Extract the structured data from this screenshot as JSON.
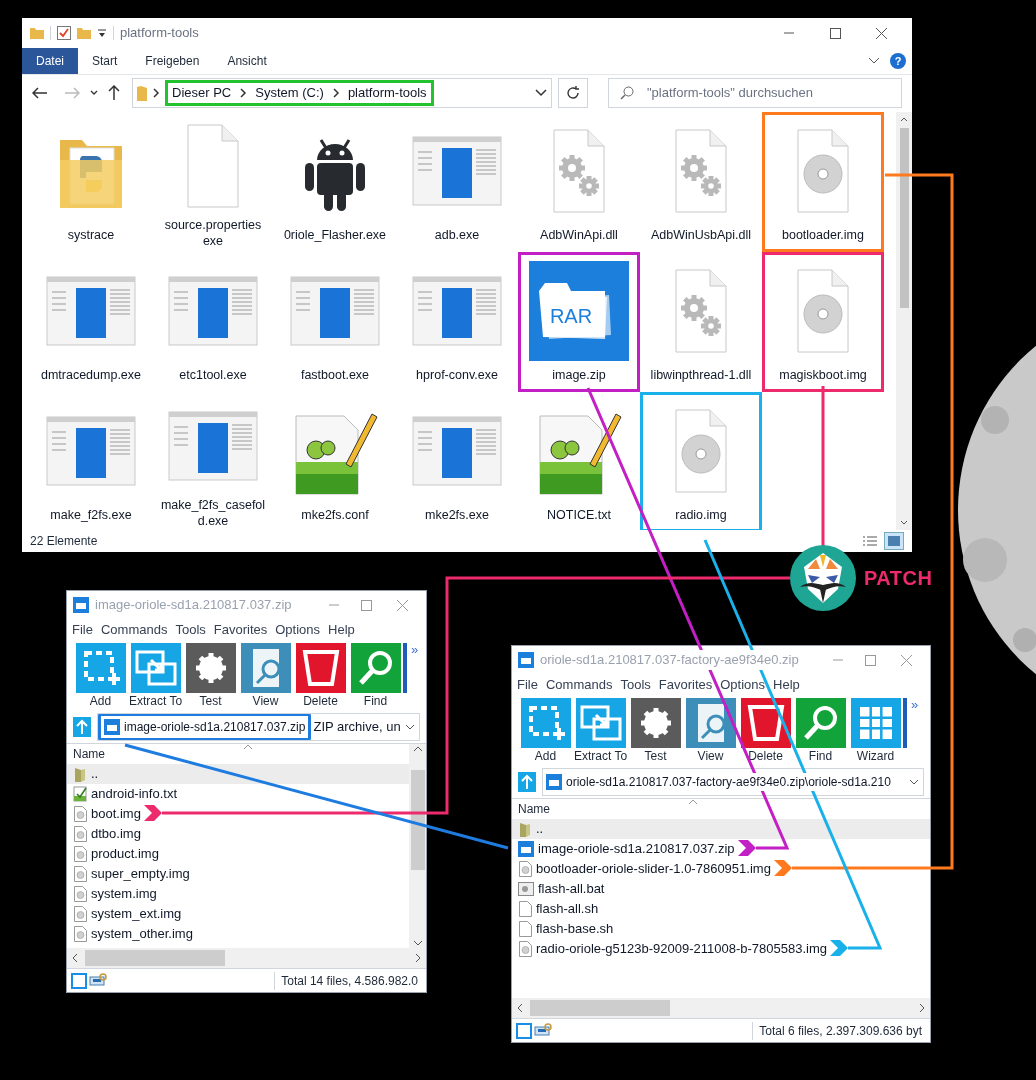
{
  "explorer": {
    "title": "platform-tools",
    "tabs": [
      {
        "label": "Datei",
        "selected": true
      },
      {
        "label": "Start",
        "selected": false
      },
      {
        "label": "Freigeben",
        "selected": false
      },
      {
        "label": "Ansicht",
        "selected": false
      }
    ],
    "help_label": "?",
    "address": {
      "crumbs": [
        "Dieser PC",
        "System (C:)",
        "platform-tools"
      ],
      "color": "#22c32e"
    },
    "search": {
      "placeholder": "\"platform-tools\" durchsuchen"
    },
    "files": [
      {
        "name": "systrace",
        "kind": "folder"
      },
      {
        "name": "source.properties exe",
        "kind": "blank"
      },
      {
        "name": "0riole_Flasher.exe",
        "kind": "android"
      },
      {
        "name": "adb.exe",
        "kind": "app"
      },
      {
        "name": "AdbWinApi.dll",
        "kind": "dll"
      },
      {
        "name": "AdbWinUsbApi.dll",
        "kind": "dll"
      },
      {
        "name": "bootloader.img",
        "kind": "disc",
        "color": "#ff7a1f"
      },
      {
        "name": "dmtracedump.exe",
        "kind": "app"
      },
      {
        "name": "etc1tool.exe",
        "kind": "app"
      },
      {
        "name": "fastboot.exe",
        "kind": "app"
      },
      {
        "name": "hprof-conv.exe",
        "kind": "app"
      },
      {
        "name": "image.zip",
        "kind": "rar",
        "badge": "RAR",
        "color": "#c21fc4"
      },
      {
        "name": "libwinpthread-1.dll",
        "kind": "dll"
      },
      {
        "name": "magiskboot.img",
        "kind": "disc",
        "color": "#ec2a6c"
      },
      {
        "name": "make_f2fs.exe",
        "kind": "app"
      },
      {
        "name": "make_f2fs_casefold.exe",
        "kind": "app"
      },
      {
        "name": "mke2fs.conf",
        "kind": "notepad"
      },
      {
        "name": "mke2fs.exe",
        "kind": "app"
      },
      {
        "name": "NOTICE.txt",
        "kind": "notepad"
      },
      {
        "name": "radio.img",
        "kind": "disc",
        "color": "#1ab0ea"
      }
    ],
    "status": "22 Elemente"
  },
  "archives": [
    {
      "title": "image-oriole-sd1a.210817.037.zip",
      "menu": [
        "File",
        "Commands",
        "Tools",
        "Favorites",
        "Options",
        "Help"
      ],
      "tools": [
        {
          "label": "Add",
          "kind": "add",
          "color": "#16a6e6"
        },
        {
          "label": "Extract To",
          "kind": "extract",
          "color": "#16a6e6"
        },
        {
          "label": "Test",
          "kind": "test",
          "color": "#5b5b5b"
        },
        {
          "label": "View",
          "kind": "view",
          "color": "#3d8fba"
        },
        {
          "label": "Delete",
          "kind": "delete",
          "color": "#e1162c"
        },
        {
          "label": "Find",
          "kind": "find",
          "color": "#12a33a"
        }
      ],
      "overflow": "»",
      "address": {
        "path": "image-oriole-sd1a.210817.037.zip",
        "color": "#1e7ce0",
        "type_text": "ZIP archive, un"
      },
      "column": "Name",
      "rows": [
        {
          "name": "..",
          "kind": "parent",
          "selected": true
        },
        {
          "name": "android-info.txt",
          "kind": "txt",
          "selected": false
        },
        {
          "name": "boot.img",
          "kind": "img",
          "selected": false
        },
        {
          "name": "dtbo.img",
          "kind": "img",
          "selected": false
        },
        {
          "name": "product.img",
          "kind": "img",
          "selected": false
        },
        {
          "name": "super_empty.img",
          "kind": "img",
          "selected": false
        },
        {
          "name": "system.img",
          "kind": "img",
          "selected": false
        },
        {
          "name": "system_ext.img",
          "kind": "img",
          "selected": false
        },
        {
          "name": "system_other.img",
          "kind": "img",
          "selected": false
        }
      ],
      "status": "Total 14 files, 4.586.982.0"
    },
    {
      "title": "oriole-sd1a.210817.037-factory-ae9f34e0.zip",
      "menu": [
        "File",
        "Commands",
        "Tools",
        "Favorites",
        "Options",
        "Help"
      ],
      "tools": [
        {
          "label": "Add",
          "kind": "add",
          "color": "#16a6e6"
        },
        {
          "label": "Extract To",
          "kind": "extract",
          "color": "#16a6e6"
        },
        {
          "label": "Test",
          "kind": "test",
          "color": "#5b5b5b"
        },
        {
          "label": "View",
          "kind": "view",
          "color": "#3d8fba"
        },
        {
          "label": "Delete",
          "kind": "delete",
          "color": "#e1162c"
        },
        {
          "label": "Find",
          "kind": "find",
          "color": "#12a33a"
        },
        {
          "label": "Wizard",
          "kind": "wizard",
          "color": "#16a6e6"
        }
      ],
      "overflow": "»",
      "address": {
        "path": "oriole-sd1a.210817.037-factory-ae9f34e0.zip\\oriole-sd1a.210"
      },
      "column": "Name",
      "rows": [
        {
          "name": "..",
          "kind": "parent",
          "selected": true
        },
        {
          "name": "image-oriole-sd1a.210817.037.zip",
          "kind": "zip",
          "selected": false
        },
        {
          "name": "bootloader-oriole-slider-1.0-7860951.img",
          "kind": "img",
          "selected": false
        },
        {
          "name": "flash-all.bat",
          "kind": "bat",
          "selected": false
        },
        {
          "name": "flash-all.sh",
          "kind": "sh",
          "selected": false
        },
        {
          "name": "flash-base.sh",
          "kind": "sh",
          "selected": false
        },
        {
          "name": "radio-oriole-g5123b-92009-211008-b-7805583.img",
          "kind": "img",
          "selected": false
        }
      ],
      "status": "Total 6 files, 2.397.309.636 byt"
    }
  ],
  "patch_label": "PATCH",
  "connectors": [
    {
      "color": "#ff7a1f"
    },
    {
      "color": "#c21fc4"
    },
    {
      "color": "#ec2a6c"
    },
    {
      "color": "#1ab0ea"
    },
    {
      "color": "#1e7ce0"
    }
  ]
}
